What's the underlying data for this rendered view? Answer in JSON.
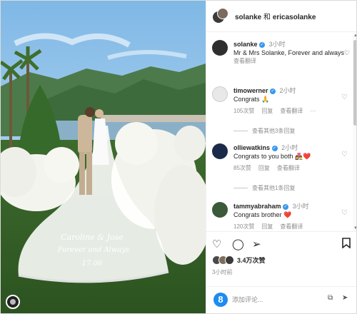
{
  "header": {
    "user1": "solanke",
    "conj": "和",
    "user2": "ericasolanke"
  },
  "caption": {
    "username": "solanke",
    "time": "3小时",
    "text": "Mr & Mrs Solanke, Forever and always♡",
    "translate": "查看翻译"
  },
  "comments": [
    {
      "username": "timowerner",
      "time": "2小时",
      "text": "Congrats",
      "emoji": "🙏",
      "likes": "105次赞",
      "reply": "回复",
      "translate": "查看翻译",
      "more": "···",
      "view_replies": "查看其他3条回复"
    },
    {
      "username": "olliewatkins",
      "time": "2小时",
      "text": "Congrats to you both",
      "emoji": "👩‍❤️‍👨❤️",
      "likes": "85次赞",
      "reply": "回复",
      "translate": "查看翻译",
      "view_replies": "查看其他1条回复"
    },
    {
      "username": "tammyabraham",
      "time": "3小时",
      "text": "Congrats brother",
      "emoji": "❤️",
      "likes": "120次赞",
      "reply": "回复",
      "translate": "查看翻译"
    }
  ],
  "likes": {
    "count": "3.4万次赞"
  },
  "posted": "3小时前",
  "add_comment": {
    "placeholder": "添加评论..."
  },
  "photo": {
    "veil_text_1": "Caroline & Jose",
    "veil_text_2": "Forever and Always",
    "veil_text_3": "17.06"
  },
  "colors": {
    "verified": "#3897f0",
    "heart": "#ed4956"
  },
  "icons": [
    "heart-icon",
    "comment-icon",
    "share-icon",
    "bookmark-icon",
    "verified-icon",
    "emoji-icon",
    "gif-icon",
    "send-icon"
  ]
}
